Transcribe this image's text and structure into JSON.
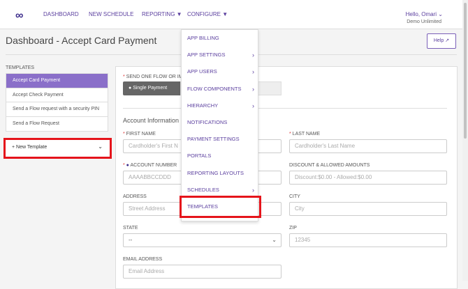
{
  "nav": {
    "items": [
      "DASHBOARD",
      "NEW SCHEDULE",
      "REPORTING",
      "CONFIGURE"
    ],
    "greeting": "Hello, Omari",
    "org": "Demo Unlimited"
  },
  "page": {
    "title": "Dashboard - Accept Card Payment",
    "help": "Help"
  },
  "templates": {
    "label": "TEMPLATES",
    "items": [
      "Accept Card Payment",
      "Accept Check Payment",
      "Send a Flow request with a security PIN",
      "Send a Flow Request"
    ],
    "new_template": "+ New Template"
  },
  "form": {
    "send_label": "SEND ONE FLOW OR IMPO",
    "single_payment": "Single Payment",
    "section": "Account Information",
    "first_name_label": "FIRST NAME",
    "first_name_ph": "Cardholder's First N",
    "last_name_label": "LAST NAME",
    "last_name_ph": "Cardholder's Last Name",
    "account_label": "ACCOUNT NUMBER",
    "account_ph": "AAAABBCCDDD",
    "discount_label": "DISCOUNT & ALLOWED AMOUNTS",
    "discount_ph": "Discount:$0.00 - Allowed:$0.00",
    "address_label": "ADDRESS",
    "address_ph": "Street Address",
    "city_label": "CITY",
    "city_ph": "City",
    "state_label": "STATE",
    "state_value": "--",
    "zip_label": "ZIP",
    "zip_ph": "12345",
    "email_label": "EMAIL ADDRESS",
    "email_ph": "Email Address"
  },
  "menu": {
    "items": [
      {
        "label": "APP BILLING",
        "sub": false
      },
      {
        "label": "APP SETTINGS",
        "sub": true
      },
      {
        "label": "APP USERS",
        "sub": true
      },
      {
        "label": "FLOW COMPONENTS",
        "sub": true
      },
      {
        "label": "HIERARCHY",
        "sub": true
      },
      {
        "label": "NOTIFICATIONS",
        "sub": false
      },
      {
        "label": "PAYMENT SETTINGS",
        "sub": false
      },
      {
        "label": "PORTALS",
        "sub": false
      },
      {
        "label": "REPORTING LAYOUTS",
        "sub": false
      },
      {
        "label": "SCHEDULES",
        "sub": true
      },
      {
        "label": "TEMPLATES",
        "sub": false
      }
    ]
  },
  "colors": {
    "accent": "#5a3e9e",
    "active": "#8a6fc9",
    "highlight": "#e5141b"
  }
}
